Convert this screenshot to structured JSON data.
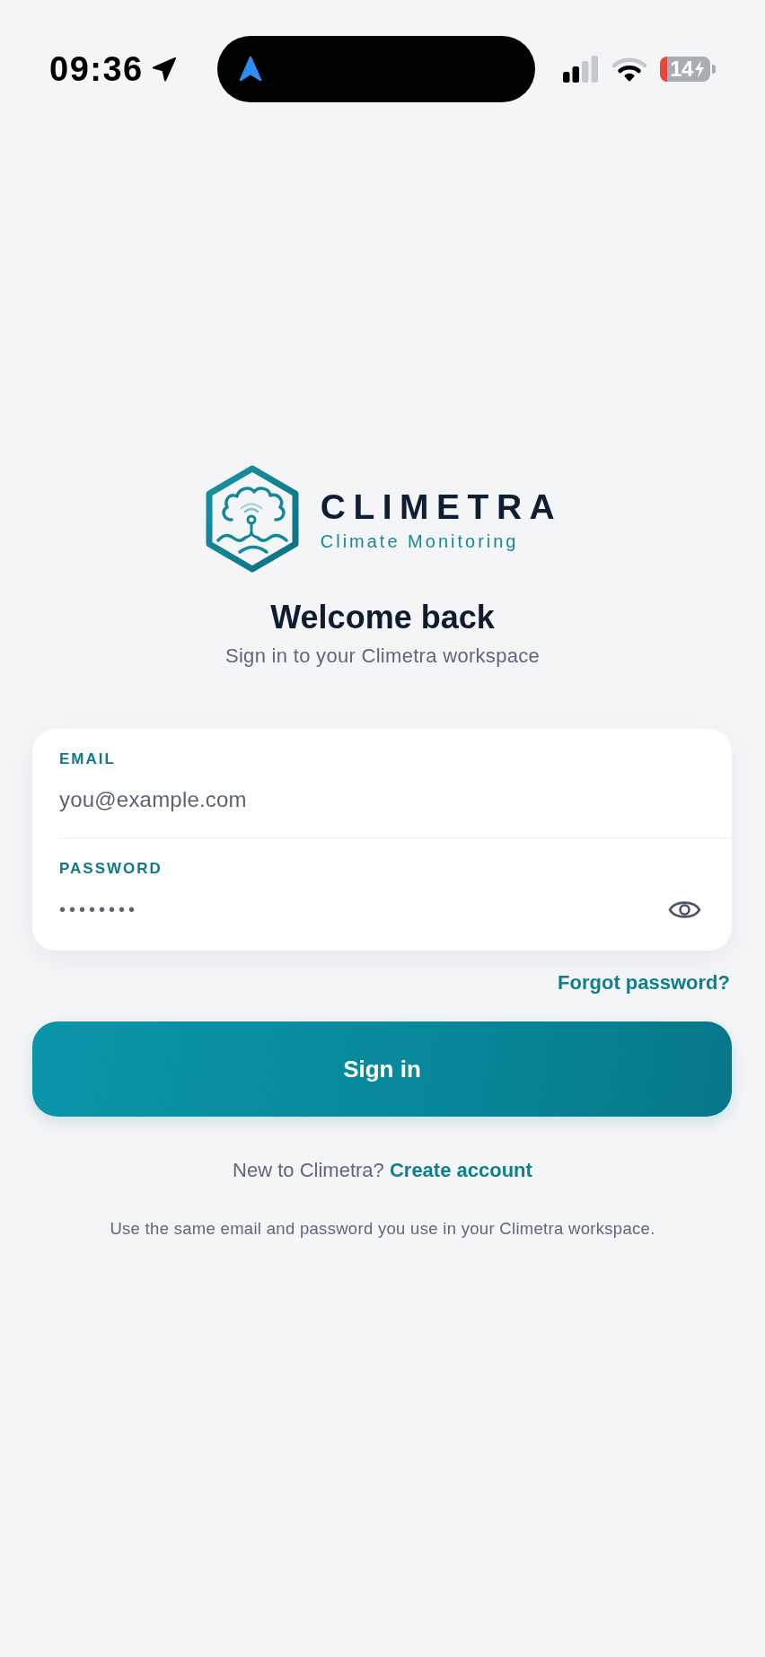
{
  "status_bar": {
    "time": "09:36",
    "battery_percent": "14"
  },
  "logo": {
    "wordmark": "CLIMETRA",
    "tagline": "Climate Monitoring"
  },
  "heading": "Welcome back",
  "subtitle": "Sign in to your Climetra workspace",
  "form": {
    "fields": [
      {
        "kind": "email",
        "label": "EMAIL",
        "placeholder": "you@example.com"
      },
      {
        "kind": "password",
        "label": "PASSWORD",
        "value": "••••••••"
      }
    ],
    "forgot_link": "Forgot password?"
  },
  "primary_button": "Sign in",
  "signup_prompt": {
    "text": "New to Climetra?",
    "link": "Create account"
  },
  "note": "Use the same email and password you use in your Climetra workspace."
}
